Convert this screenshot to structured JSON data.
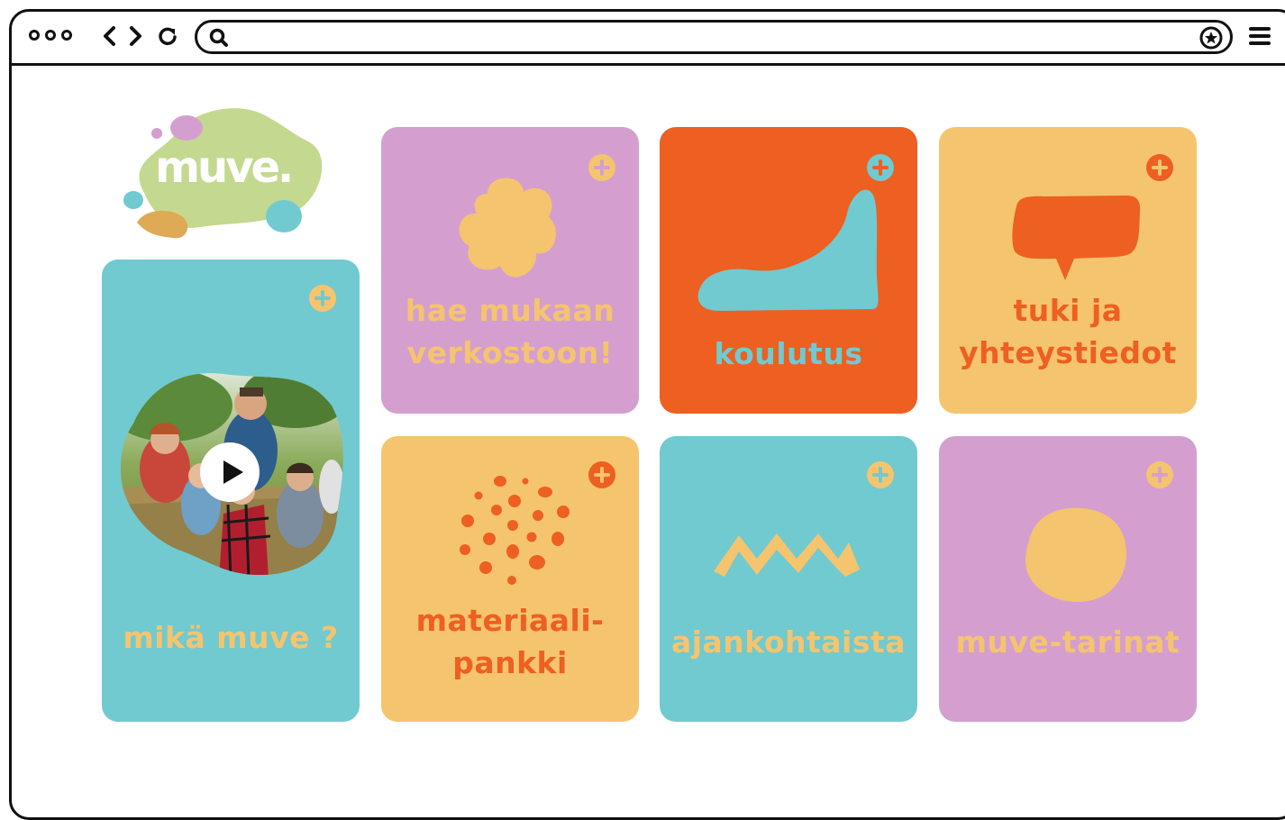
{
  "browser": {
    "back_icon": "chevron-left-icon",
    "forward_icon": "chevron-right-icon",
    "reload_icon": "reload-icon",
    "search_icon": "search-icon",
    "bookmark_icon": "star-icon",
    "menu_icon": "hamburger-menu-icon",
    "url": ""
  },
  "logo": {
    "text": "muve."
  },
  "colors": {
    "purple": "#d49fcf",
    "orange": "#ee5f22",
    "yellow": "#f5c46e",
    "teal": "#70cad0",
    "green": "#c3d98f"
  },
  "tiles": [
    {
      "label": "mikä muve ?",
      "icon": "video-thumbnail"
    },
    {
      "label_lines": [
        "hae mukaan",
        "verkostoon!"
      ],
      "icon": "flower-blob-icon"
    },
    {
      "label": "koulutus",
      "icon": "wave-shape-icon"
    },
    {
      "label_lines": [
        "tuki ja",
        "yhteystiedot"
      ],
      "icon": "speech-bubble-icon"
    },
    {
      "label_lines": [
        "materiaali-",
        "pankki"
      ],
      "icon": "dots-cluster-icon"
    },
    {
      "label": "ajankohtaista",
      "icon": "zigzag-icon"
    },
    {
      "label": "muve-tarinat",
      "icon": "circle-blob-icon"
    }
  ]
}
